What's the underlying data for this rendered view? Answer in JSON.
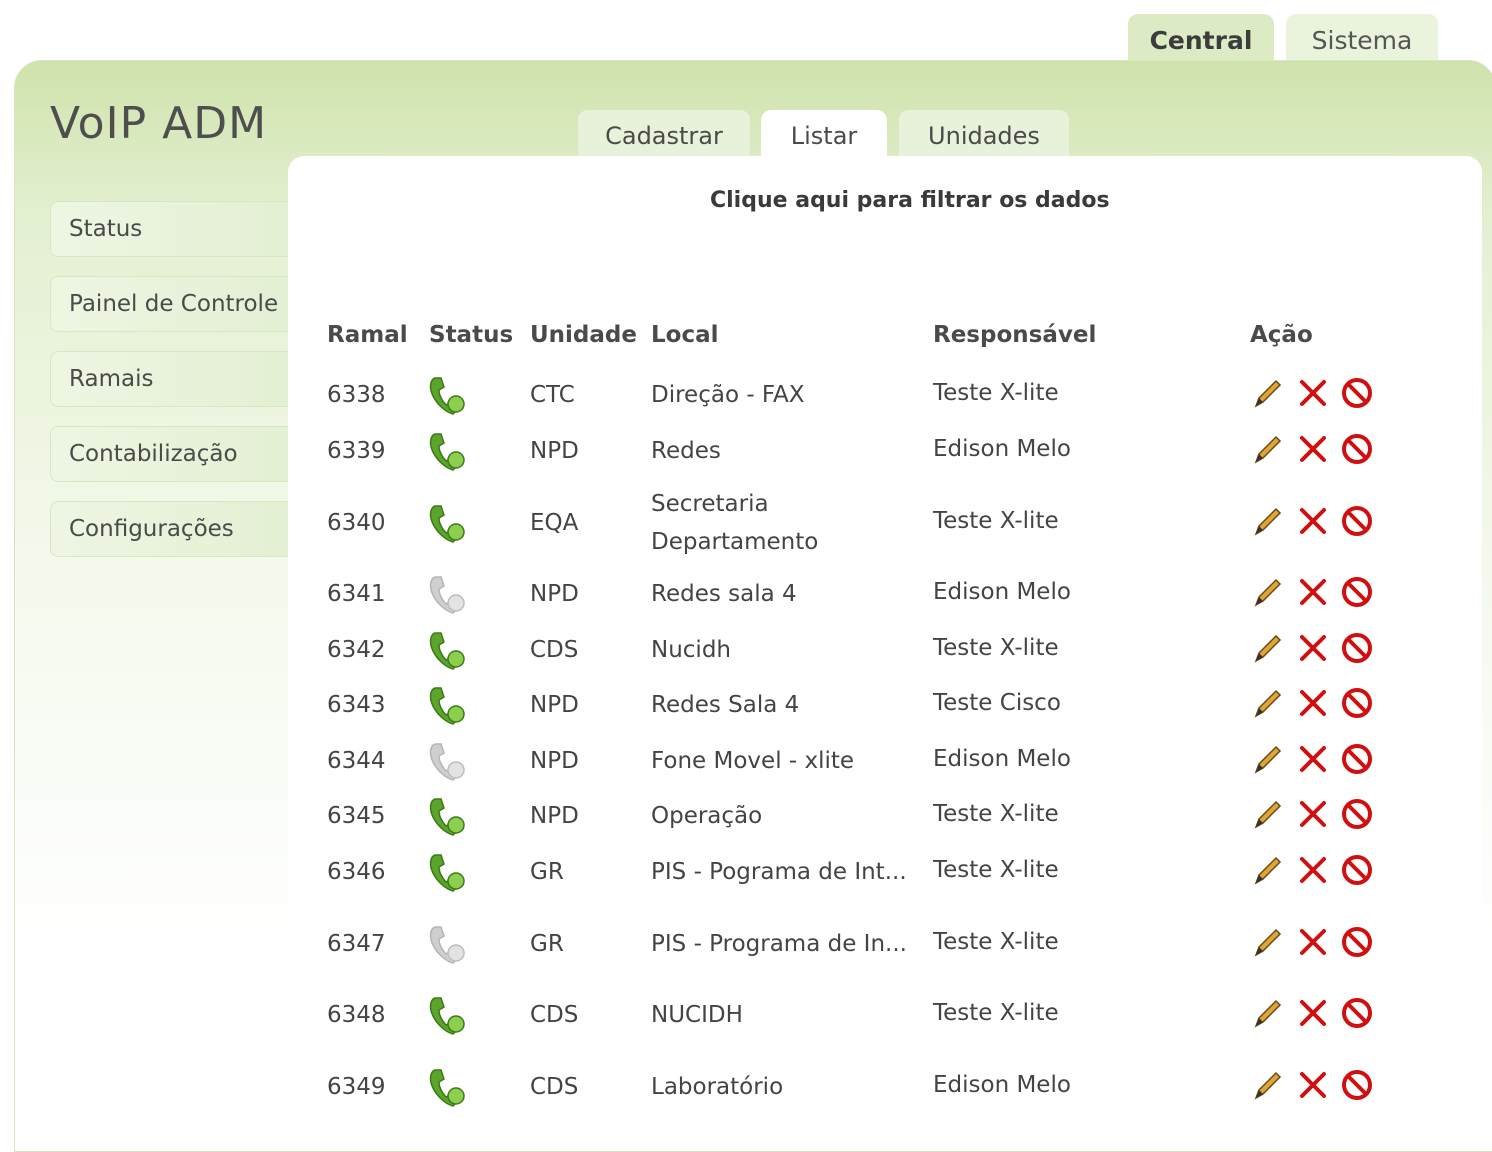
{
  "top_tabs": {
    "central": "Central",
    "sistema": "Sistema"
  },
  "logo": "VoIP ADM",
  "sidebar": {
    "items": [
      {
        "label": "Status"
      },
      {
        "label": "Painel de Controle"
      },
      {
        "label": "Ramais"
      },
      {
        "label": "Contabilização"
      },
      {
        "label": "Configurações"
      }
    ]
  },
  "sub_tabs": {
    "cadastrar": "Cadastrar",
    "listar": "Listar",
    "unidades": "Unidades"
  },
  "filter_link": "Clique aqui para filtrar os dados",
  "table": {
    "headers": {
      "ramal": "Ramal",
      "status": "Status",
      "unidade": "Unidade",
      "local": "Local",
      "responsavel": "Responsável",
      "acao": "Ação"
    },
    "rows": [
      {
        "ramal": "6338",
        "status": "online",
        "unidade": "CTC",
        "local": "Direção - FAX",
        "local2": "",
        "responsavel": "Teste X-lite"
      },
      {
        "ramal": "6339",
        "status": "online",
        "unidade": "NPD",
        "local": "Redes",
        "local2": "",
        "responsavel": "Edison Melo"
      },
      {
        "ramal": "6340",
        "status": "online",
        "unidade": "EQA",
        "local": "Secretaria",
        "local2": "Departamento",
        "responsavel": "Teste X-lite"
      },
      {
        "ramal": "6341",
        "status": "offline",
        "unidade": "NPD",
        "local": "Redes sala 4",
        "local2": "",
        "responsavel": "Edison Melo"
      },
      {
        "ramal": "6342",
        "status": "online",
        "unidade": "CDS",
        "local": "Nucidh",
        "local2": "",
        "responsavel": "Teste X-lite"
      },
      {
        "ramal": "6343",
        "status": "online",
        "unidade": "NPD",
        "local": "Redes Sala 4",
        "local2": "",
        "responsavel": "Teste Cisco"
      },
      {
        "ramal": "6344",
        "status": "offline",
        "unidade": "NPD",
        "local": "Fone Movel - xlite",
        "local2": "",
        "responsavel": "Edison Melo"
      },
      {
        "ramal": "6345",
        "status": "online",
        "unidade": "NPD",
        "local": "Operação",
        "local2": "",
        "responsavel": "Teste X-lite"
      },
      {
        "ramal": "6346",
        "status": "online",
        "unidade": "GR",
        "local": "PIS - Pograma de Int...",
        "local2": "",
        "responsavel": "Teste X-lite"
      },
      {
        "ramal": "6347",
        "status": "offline",
        "unidade": "GR",
        "local": "PIS - Programa de In...",
        "local2": "",
        "responsavel": "Teste X-lite"
      },
      {
        "ramal": "6348",
        "status": "online",
        "unidade": "CDS",
        "local": "NUCIDH",
        "local2": "",
        "responsavel": "Teste X-lite"
      },
      {
        "ramal": "6349",
        "status": "online",
        "unidade": "CDS",
        "local": "Laboratório",
        "local2": "",
        "responsavel": "Edison Melo"
      }
    ]
  },
  "icons": {
    "status_online": "phone-online-icon",
    "status_offline": "phone-offline-icon",
    "edit": "pencil-icon",
    "delete": "x-icon",
    "block": "block-icon"
  },
  "colors": {
    "online": "#5aa52a",
    "offline": "#cfcfcf",
    "delete": "#d01010",
    "block": "#d01010"
  }
}
